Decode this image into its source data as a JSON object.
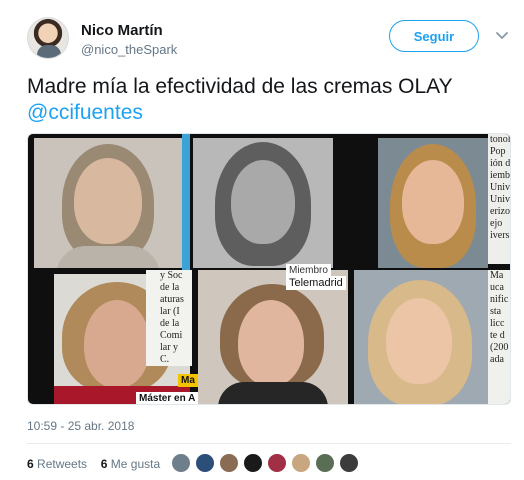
{
  "user": {
    "name": "Nico Martín",
    "handle": "@nico_theSpark"
  },
  "follow_button": {
    "label": "Seguir"
  },
  "tweet": {
    "text": "Madre mía la efectividad de las cremas OLAY",
    "mention": "@ccifuentes",
    "timestamp": "10:59 - 25 abr. 2018"
  },
  "media": {
    "paper_snippets": {
      "top_right": "tonol\nPop\nión d\niemb\nUnive\nUnive\nerizo\nejo\nivers",
      "mid_left": "y Soc\nde la\naturas\nlar (I\nde la\nComi\nlar y\nC.",
      "mid_right": "Ma\nuca\nnific\nsta\nlicc\nte d\n(200\nada",
      "telemadrid_top": "Miembro",
      "telemadrid": "Telemadrid",
      "master": "Máster en A",
      "ma_badge": "Ma"
    }
  },
  "stats": {
    "retweets_count": "6",
    "retweets_label": "Retweets",
    "likes_count": "6",
    "likes_label": "Me gusta"
  },
  "colors": {
    "accent": "#1da1f2",
    "text_primary": "#14171a",
    "text_secondary": "#657786"
  }
}
